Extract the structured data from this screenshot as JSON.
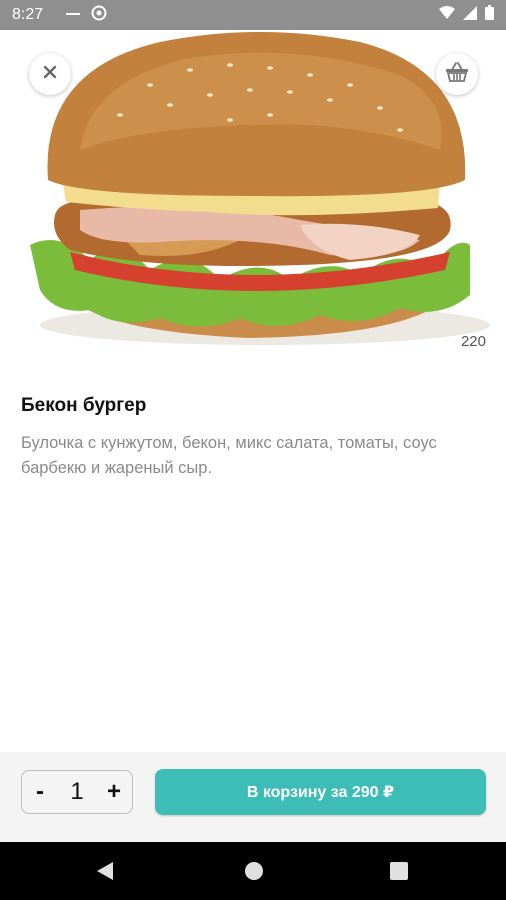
{
  "status_bar": {
    "time": "8:27",
    "icons": [
      "sim-icon",
      "dnd-icon",
      "wifi-icon",
      "signal-icon",
      "battery-icon"
    ]
  },
  "product": {
    "name": "Бекон бургер",
    "description": "Булочка с кунжутом, бекон, микс салата, томаты, соус барбекю и жареный сыр.",
    "weight": "220",
    "image": "bacon-burger-photo"
  },
  "toolbar": {
    "close_icon": "close-icon",
    "basket_icon": "basket-icon"
  },
  "quantity": {
    "minus_label": "-",
    "value": "1",
    "plus_label": "+"
  },
  "cart_button": {
    "label": "В корзину за 290 ₽"
  },
  "colors": {
    "accent": "#3dbcb8",
    "status_bar": "#8f8f8f",
    "nav_bar": "#000000",
    "action_bar": "#f4f4f4"
  },
  "nav": {
    "items": [
      "back-icon",
      "home-icon",
      "recents-icon"
    ]
  }
}
